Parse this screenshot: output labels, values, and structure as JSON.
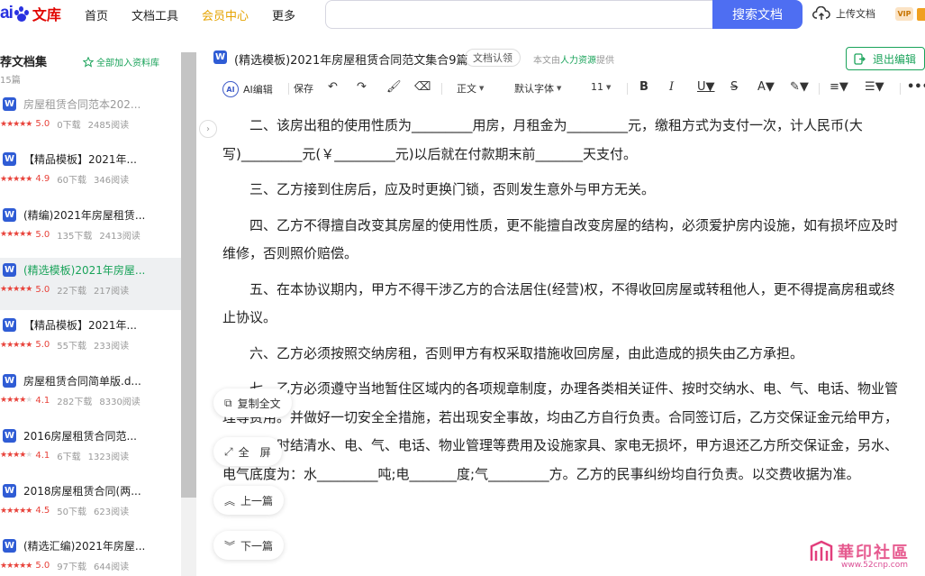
{
  "nav": {
    "logo_mark": "ai",
    "logo_text": "文库",
    "items": [
      "首页",
      "文档工具",
      "会员中心",
      "更多"
    ],
    "search_button": "搜索文档",
    "upload": "上传文档",
    "vip": "VIP"
  },
  "sidebar": {
    "title": "荐文档集",
    "count": "15篇",
    "add_all": "全部加入资料库",
    "items": [
      {
        "name": "房屋租赁合同范本202...",
        "score": "5.0",
        "downloads": "0下载",
        "reads": "2485阅读",
        "stars": 5,
        "state": "dim"
      },
      {
        "name": "【精品模板】2021年...",
        "score": "4.9",
        "downloads": "60下载",
        "reads": "346阅读",
        "stars": 5,
        "state": ""
      },
      {
        "name": "(精编)2021年房屋租赁...",
        "score": "5.0",
        "downloads": "135下载",
        "reads": "2413阅读",
        "stars": 5,
        "state": ""
      },
      {
        "name": "(精选模板)2021年房屋...",
        "score": "5.0",
        "downloads": "22下载",
        "reads": "217阅读",
        "stars": 5,
        "state": "active"
      },
      {
        "name": "【精品模板】2021年...",
        "score": "5.0",
        "downloads": "55下载",
        "reads": "233阅读",
        "stars": 5,
        "state": ""
      },
      {
        "name": "房屋租赁合同简单版.d...",
        "score": "4.1",
        "downloads": "282下载",
        "reads": "8330阅读",
        "stars": 4,
        "state": ""
      },
      {
        "name": "2016房屋租赁合同范...",
        "score": "4.1",
        "downloads": "6下载",
        "reads": "1323阅读",
        "stars": 4,
        "state": ""
      },
      {
        "name": "2018房屋租赁合同(两...",
        "score": "4.5",
        "downloads": "50下载",
        "reads": "623阅读",
        "stars": 4.5,
        "state": ""
      },
      {
        "name": "(精选汇编)2021年房屋...",
        "score": "5.0",
        "downloads": "97下载",
        "reads": "644阅读",
        "stars": 5,
        "state": ""
      }
    ]
  },
  "doc": {
    "title": "(精选模板)2021年房屋租赁合同范文集合9篇",
    "cert": "文档认领",
    "provider_prefix": "本文由",
    "provider": "人力资源",
    "provider_suffix": "提供",
    "exit": "退出编辑"
  },
  "toolbar": {
    "ai": "AI编辑",
    "save": "保存",
    "style": "正文",
    "font": "默认字体",
    "size": "11"
  },
  "body": {
    "paragraphs": [
      "二、该房出租的使用性质为_________用房，月租金为_________元，缴租方式为支付一次，计人民币(大写)_________元(￥_________元)以后就在付款期末前_______天支付。",
      "三、乙方接到住房后，应及时更换门锁，否则发生意外与甲方无关。",
      "四、乙方不得擅自改变其房屋的使用性质，更不能擅自改变房屋的结构，必须爱护房内设施，如有损坏应及时维修，否则照价赔偿。",
      "五、在本协议期内，甲方不得干涉乙方的合法居住(经营)权，不得收回房屋或转租他人，更不得提高房租或终止协议。",
      "六、乙方必须按照交纳房租，否则甲方有权采取措施收回房屋，由此造成的损失由乙方承担。",
      "七、乙方必须遵守当地暂住区域内的各项规章制度，办理各类相关证件、按时交纳水、电、气、电话、物业管理等费用。并做好一切安全全措施，若出现安全事故，均由乙方自行负责。合同签订后，乙方交保证金元给甲方，乙方退房时结清水、电、气、电话、物业管理等费用及设施家具、家电无损坏，甲方退还乙方所交保证金，另水、电气底度为：水_________吨;电_______度;气_________方。乙方的民事纠纷均自行负责。以交费收据为准。"
    ]
  },
  "float": {
    "copy": "复制全文",
    "fullscreen": "全　屏",
    "prev": "上一篇",
    "next": "下一篇"
  },
  "watermark": {
    "text": "華印社區",
    "url": "www.52cnp.com"
  }
}
